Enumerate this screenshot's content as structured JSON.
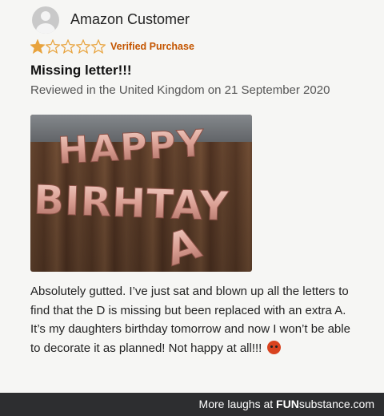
{
  "review": {
    "username": "Amazon Customer",
    "rating": 1,
    "rating_max": 5,
    "verified": "Verified Purchase",
    "title": "Missing letter!!!",
    "meta": "Reviewed in the United Kingdom on 21 September 2020",
    "photo": {
      "line1": "HAPPY",
      "line2": "BIRHTAY",
      "line3": "A"
    },
    "body": "Absolutely gutted. I’ve just sat and blown up all the letters to find that the D is missing but been replaced with an extra A. It’s my daughters birthday tomorrow and now I won’t be able to decorate it as planned! Not happy at all!!!",
    "emoji": "angry-face-emoji"
  },
  "footer": {
    "prefix": "More laughs at",
    "brand_fun": "FUN",
    "brand_sub": "substance.com"
  },
  "colors": {
    "star": "#e8a33d",
    "verified": "#c45500",
    "balloon": "#e6b1a6",
    "footer": "#2d2e30"
  }
}
